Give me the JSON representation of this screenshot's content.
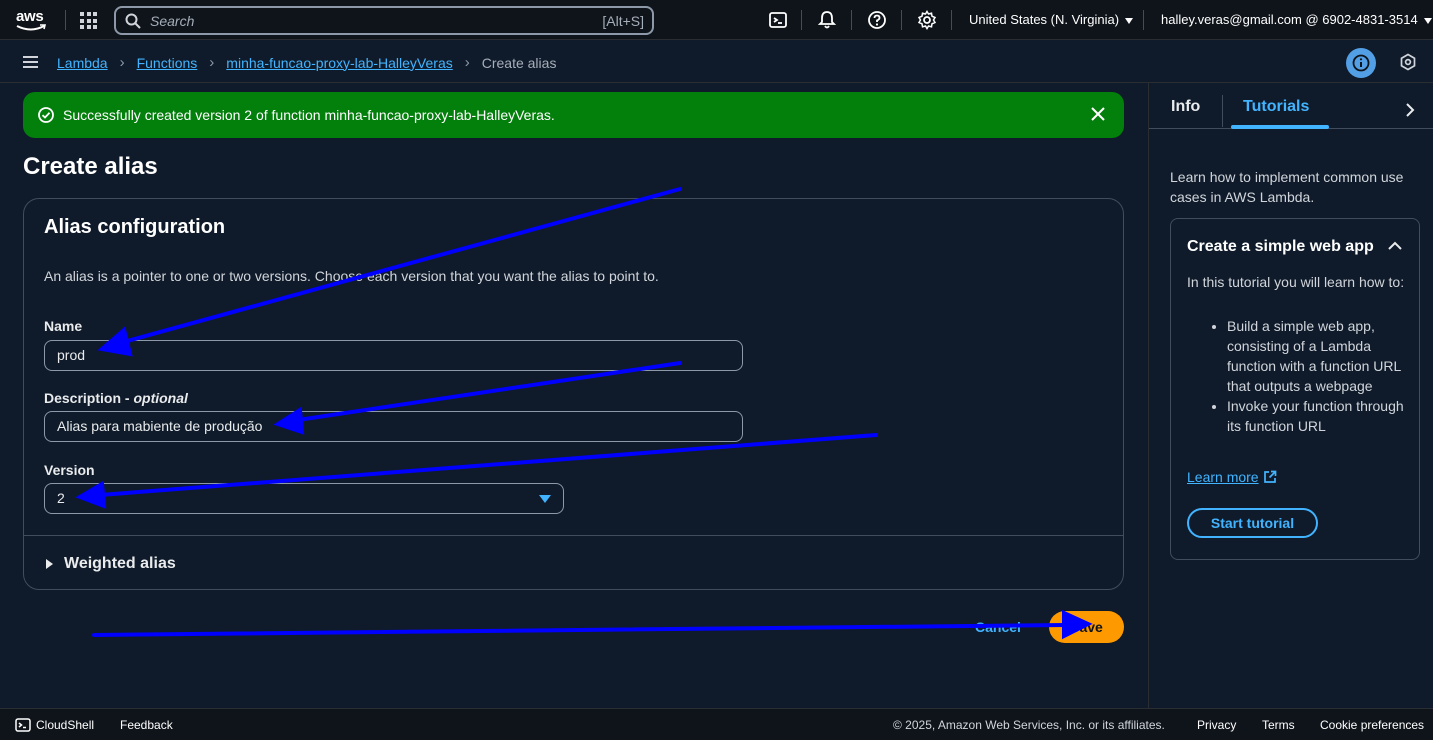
{
  "topnav": {
    "logo_text": "aws",
    "search_placeholder": "Search",
    "search_shortcut": "[Alt+S]",
    "icons": [
      "cloudshell-icon",
      "bell-icon",
      "help-icon",
      "gear-icon"
    ],
    "region": "United States (N. Virginia)",
    "account": "halley.veras@gmail.com @ 6902-4831-3514"
  },
  "breadcrumb": {
    "items": [
      "Lambda",
      "Functions",
      "minha-funcao-proxy-lab-HalleyVeras"
    ],
    "current": "Create alias"
  },
  "flash": {
    "message": "Successfully created version 2 of function minha-funcao-proxy-lab-HalleyVeras."
  },
  "page": {
    "title": "Create alias"
  },
  "alias_config": {
    "heading": "Alias configuration",
    "description": "An alias is a pointer to one or two versions. Choose each version that you want the alias to point to.",
    "name_label": "Name",
    "name_value": "prod",
    "description_label": "Description - ",
    "description_optional": "optional",
    "description_value": "Alias para mabiente de produção",
    "version_label": "Version",
    "version_value": "2",
    "weighted_label": "Weighted alias"
  },
  "actions": {
    "cancel_label": "Cancel",
    "save_label": "Save"
  },
  "help_panel": {
    "tab_info": "Info",
    "tab_tutorials": "Tutorials",
    "intro": "Learn how to implement common use cases in AWS Lambda.",
    "tutorial_title": "Create a simple web app",
    "tutorial_lead": "In this tutorial you will learn how to:",
    "tutorial_points": [
      "Build a simple web app, consisting of a Lambda function with a function URL that outputs a webpage",
      "Invoke your function through its function URL"
    ],
    "learn_more": "Learn more",
    "start_tutorial": "Start tutorial"
  },
  "footer": {
    "cloudshell": "CloudShell",
    "feedback": "Feedback",
    "copyright": "© 2025, Amazon Web Services, Inc. or its affiliates.",
    "privacy": "Privacy",
    "terms": "Terms",
    "cookie": "Cookie preferences"
  },
  "colors": {
    "accent_blue": "#42b4ff",
    "success_green": "#037f0c",
    "save_orange": "#ff9900",
    "annotation_arrow": "#0000ff"
  }
}
